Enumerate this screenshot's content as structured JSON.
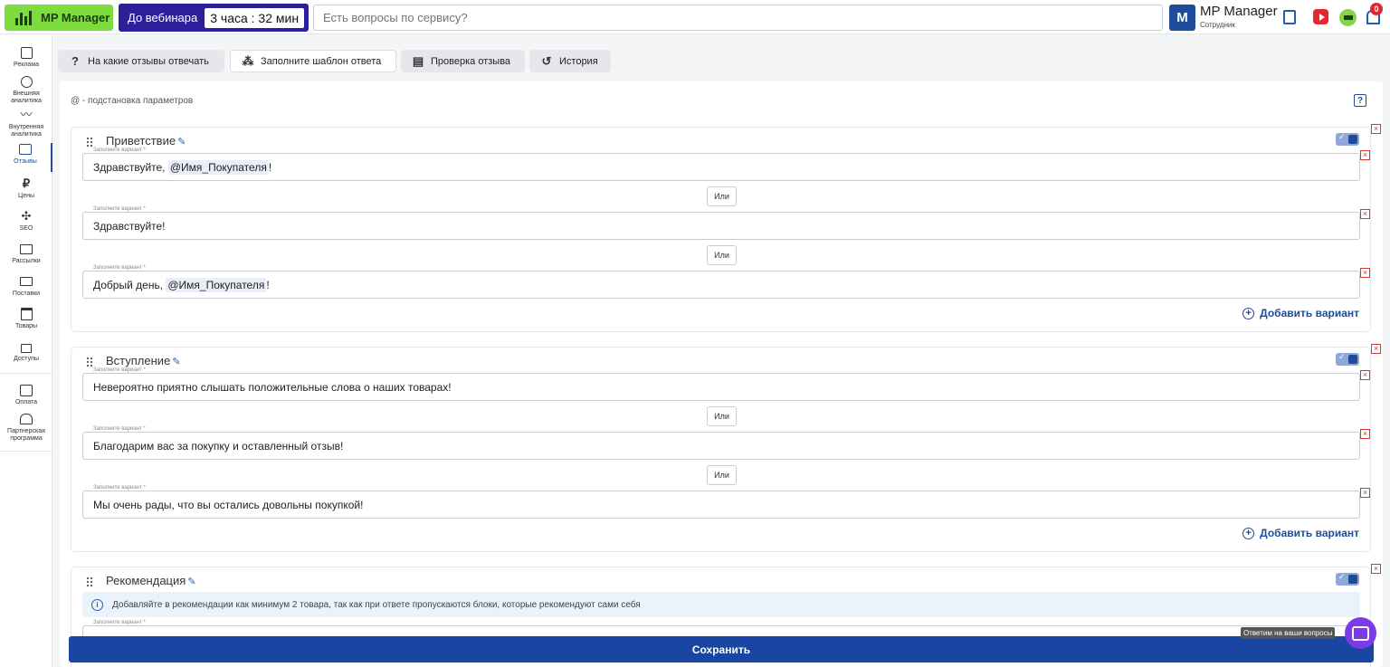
{
  "topbar": {
    "logo_label": "MP Manager",
    "webinar_label": "До вебинара",
    "webinar_timer": "3 часа : 32 мин",
    "search_placeholder": "Есть вопросы по сервису?",
    "user_initial": "M",
    "user_name": "MP Manager",
    "user_role": "Сотрудник",
    "notifications_count": "0",
    "icons": [
      "copy-icon",
      "video-icon",
      "graduation-icon",
      "bell-icon"
    ]
  },
  "sidebar": {
    "items": [
      {
        "label": "Реклама",
        "icon": "ads-icon"
      },
      {
        "label": "Внешняя аналитика",
        "icon": "external-analytics-icon"
      },
      {
        "label": "Внутренняя аналитика",
        "icon": "internal-analytics-icon"
      },
      {
        "label": "Отзывы",
        "icon": "reviews-icon"
      },
      {
        "label": "Цены",
        "icon": "ruble-icon"
      },
      {
        "label": "SEO",
        "icon": "seo-icon"
      },
      {
        "label": "Рассылки",
        "icon": "mail-icon"
      },
      {
        "label": "Поставки",
        "icon": "truck-icon"
      },
      {
        "label": "Товары",
        "icon": "archive-icon"
      },
      {
        "label": "Доступы",
        "icon": "lock-icon"
      },
      {
        "label": "Оплата",
        "icon": "wallet-icon"
      },
      {
        "label": "Партнерская программа",
        "icon": "partners-icon"
      }
    ],
    "active": "Отзывы"
  },
  "tabs": [
    {
      "label": "На какие отзывы отвечать",
      "icon": "question-icon",
      "glyph": "?"
    },
    {
      "label": "Заполните шаблон ответа",
      "icon": "template-icon",
      "glyph": "⁂"
    },
    {
      "label": "Проверка отзыва",
      "icon": "review-check-icon",
      "glyph": "▤"
    },
    {
      "label": "История",
      "icon": "history-icon",
      "glyph": "↺"
    }
  ],
  "active_tab": "Заполните шаблон ответа",
  "param_hint": "@ - подстановка параметров",
  "help_glyph": "?",
  "field_label": "Заполните вариант *",
  "or_label": "Или",
  "add_variant_label": "Добавить вариант",
  "blocks": [
    {
      "title": "Приветствие",
      "enabled": true,
      "variants": [
        {
          "pre": "Здравствуйте, ",
          "tag": "@Имя_Покупателя",
          "post": "!"
        },
        {
          "pre": "Здравствуйте!",
          "tag": "",
          "post": ""
        },
        {
          "pre": "Добрый день, ",
          "tag": "@Имя_Покупателя",
          "post": "!"
        }
      ]
    },
    {
      "title": "Вступление",
      "enabled": true,
      "variants": [
        {
          "pre": "Невероятно приятно слышать положительные слова о наших товарах!",
          "tag": "",
          "post": ""
        },
        {
          "pre": "Благодарим вас за покупку и оставленный отзыв!",
          "tag": "",
          "post": ""
        },
        {
          "pre": "Мы очень рады, что вы остались довольны покупкой!",
          "tag": "",
          "post": ""
        }
      ]
    },
    {
      "title": "Рекомендация",
      "enabled": true,
      "notice": "Добавляйте в рекомендации как минимум 2 товара, так как при ответе пропускаются блоки, которые рекомендуют сами себя"
    }
  ],
  "save_label": "Сохранить",
  "chat_tooltip": "Ответим на ваши вопросы",
  "colors": {
    "brand_green": "#7ddc3e",
    "webinar_purple": "#2c1f9a",
    "primary_blue": "#1a46a3",
    "chat_purple": "#7d3be8",
    "delete_red": "#dd3333"
  }
}
